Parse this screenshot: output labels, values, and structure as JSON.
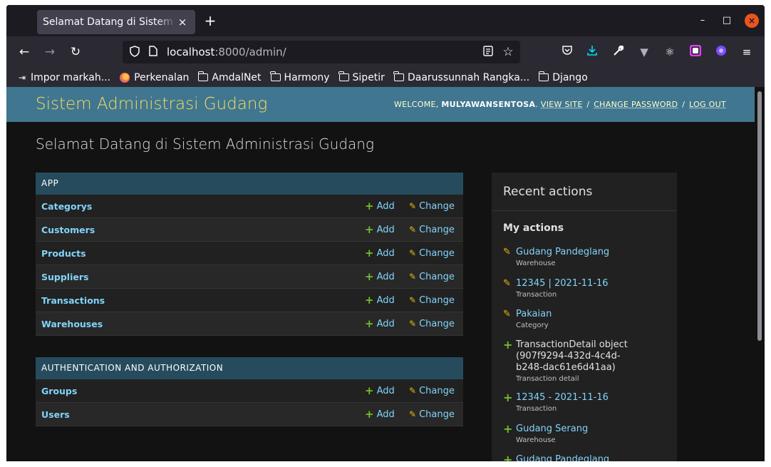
{
  "browser": {
    "tab_title": "Selamat Datang di Sistem Administrasi Gudang",
    "tab_close": "×",
    "new_tab": "+",
    "window_controls": {
      "minimize": "–",
      "maximize": "□",
      "close": "×"
    },
    "url_host": "localhost",
    "url_rest": ":8000/admin/",
    "bookmarks": [
      {
        "label": "Impor markah...",
        "icon": "import-icon"
      },
      {
        "label": "Perkenalan",
        "icon": "firefox-icon"
      },
      {
        "label": "AmdalNet",
        "icon": "folder-icon"
      },
      {
        "label": "Harmony",
        "icon": "folder-icon"
      },
      {
        "label": "Sipetir",
        "icon": "folder-icon"
      },
      {
        "label": "Daarussunnah Rangka...",
        "icon": "folder-icon"
      },
      {
        "label": "Django",
        "icon": "folder-icon"
      }
    ]
  },
  "header": {
    "branding": "Sistem Administrasi Gudang",
    "welcome": "Welcome, ",
    "username": "mulyawansentosa",
    "view_site": "View site",
    "change_password": "Change password",
    "log_out": "Log out",
    "separator": "/"
  },
  "page_title": "Selamat Datang di Sistem Administrasi Gudang",
  "apps": [
    {
      "caption": "App",
      "models": [
        {
          "name": "Categorys",
          "add": "Add",
          "change": "Change"
        },
        {
          "name": "Customers",
          "add": "Add",
          "change": "Change"
        },
        {
          "name": "Products",
          "add": "Add",
          "change": "Change"
        },
        {
          "name": "Suppliers",
          "add": "Add",
          "change": "Change"
        },
        {
          "name": "Transactions",
          "add": "Add",
          "change": "Change"
        },
        {
          "name": "Warehouses",
          "add": "Add",
          "change": "Change"
        }
      ]
    },
    {
      "caption": "Authentication and Authorization",
      "models": [
        {
          "name": "Groups",
          "add": "Add",
          "change": "Change"
        },
        {
          "name": "Users",
          "add": "Add",
          "change": "Change"
        }
      ]
    }
  ],
  "recent_actions": {
    "title": "Recent actions",
    "subtitle": "My actions",
    "items": [
      {
        "label": "Gudang Pandeglang",
        "type": "Warehouse",
        "icon": "pencil-icon"
      },
      {
        "label": "12345 | 2021-11-16",
        "type": "Transaction",
        "icon": "pencil-icon"
      },
      {
        "label": "Pakaian",
        "type": "Category",
        "icon": "pencil-icon"
      },
      {
        "label": "TransactionDetail object (907f9294-432d-4c4d-b248-dac61e6d41aa)",
        "type": "Transaction detail",
        "icon": "plus-icon"
      },
      {
        "label": "12345 - 2021-11-16",
        "type": "Transaction",
        "icon": "plus-icon"
      },
      {
        "label": "Gudang Serang",
        "type": "Warehouse",
        "icon": "plus-icon"
      },
      {
        "label": "Gudang Pandeglang",
        "type": "",
        "icon": "plus-icon"
      }
    ]
  },
  "colors": {
    "header_bg": "#417690",
    "branding": "#f5dd5d",
    "caption_bg": "#264b5d",
    "link": "#81d4fa",
    "add_icon": "#70bf2b",
    "change_icon": "#efb80b"
  }
}
